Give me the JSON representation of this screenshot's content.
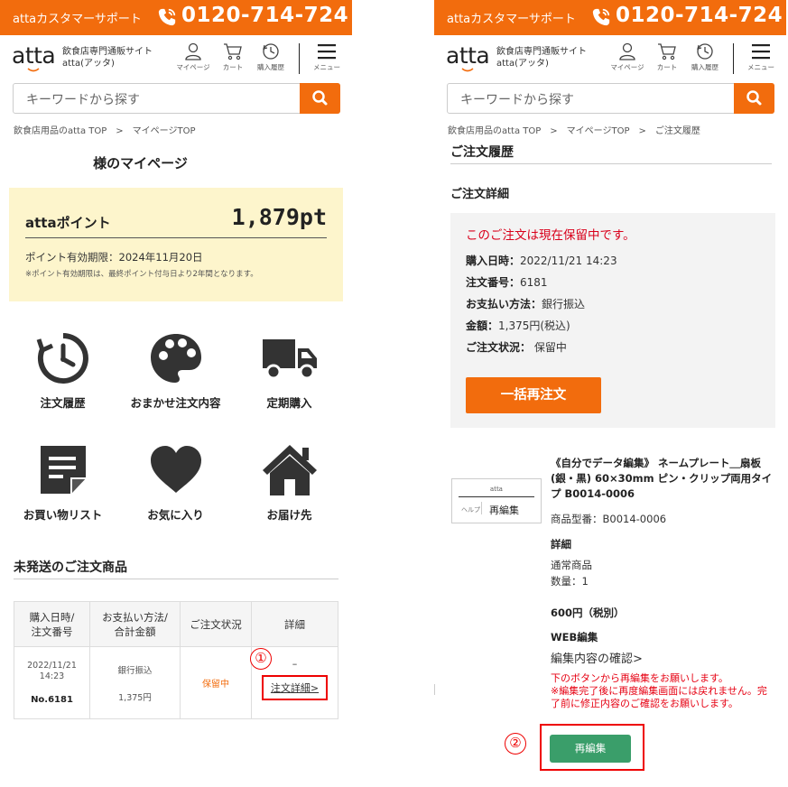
{
  "support": {
    "label": "attaカスタマーサポート",
    "phone": "0120-714-724"
  },
  "header": {
    "logo": "atta",
    "desc_line1": "飲食店専門通販サイト",
    "desc_line2": "atta(アッタ)",
    "icons": {
      "mypage": "マイページ",
      "cart": "カート",
      "history": "購入履歴",
      "menu": "メニュー"
    }
  },
  "search": {
    "placeholder": "キーワードから探す"
  },
  "left": {
    "breadcrumb": "飲食店用品のatta TOP　>　マイページTOP",
    "title": "様のマイページ",
    "points": {
      "label": "attaポイント",
      "value": "1,879pt",
      "expiry": "ポイント有効期限：2024年11月20日",
      "note": "※ポイント有効期限は、最終ポイント付与日より2年間となります。"
    },
    "tiles": [
      {
        "label": "注文履歴",
        "icon": "clock-history-icon"
      },
      {
        "label": "おまかせ注文内容",
        "icon": "palette-icon"
      },
      {
        "label": "定期購入",
        "icon": "truck-icon"
      },
      {
        "label": "お買い物リスト",
        "icon": "note-list-icon"
      },
      {
        "label": "お気に入り",
        "icon": "heart-icon"
      },
      {
        "label": "お届け先",
        "icon": "home-icon"
      }
    ],
    "unsent_title": "未発送のご注文商品",
    "table": {
      "headers": [
        "購入日時/\n注文番号",
        "お支払い方法/\n合計金額",
        "ご注文状況",
        "詳細"
      ],
      "row": {
        "date": "2022/11/21\n14:23",
        "order_no": "No.6181",
        "payment": "銀行振込",
        "amount": "1,375円",
        "status": "保留中",
        "dash": "–",
        "detail_link": "注文詳細>"
      }
    },
    "step_marker": "①"
  },
  "right": {
    "breadcrumb": "飲食店用品のatta TOP　>　マイページTOP　>　ご注文履歴",
    "title": "ご注文履歴",
    "subtitle": "ご注文詳細",
    "order": {
      "warning": "このご注文は現在保留中です。",
      "date_label": "購入日時：",
      "date": "2022/11/21 14:23",
      "no_label": "注文番号：",
      "no": "6181",
      "pay_label": "お支払い方法：",
      "pay": "銀行振込",
      "amt_label": "金額：",
      "amt": "1,375円(税込)",
      "status_label": "ご注文状況：",
      "status": " 保留中",
      "reorder_button": "一括再注文"
    },
    "product": {
      "thumb_brand": "atta",
      "thumb_small": "ヘルプ",
      "thumb_text": "再編集",
      "name": "《自分でデータ編集》 ネームプレート＿扇板(銀・黒) 60×30mm ピン・クリップ両用タイプ B0014-0006",
      "model": "商品型番：B0014-0006",
      "detail_label": "詳細",
      "type": "通常商品",
      "qty": "数量：1",
      "price": "600円（税別）",
      "web_edit": "WEB編集",
      "confirm_link": "編集内容の確認>",
      "notice": "下のボタンから再編集をお願いします。\n※編集完了後に再度編集画面には戻れません。完了前に修正内容のご確認をお願いします。",
      "reedit_button": "再編集"
    },
    "step_marker": "②"
  },
  "colors": {
    "orange": "#f26c0d",
    "red": "#e60012",
    "green": "#3a9e6a",
    "points_bg": "#fdf5cc"
  }
}
